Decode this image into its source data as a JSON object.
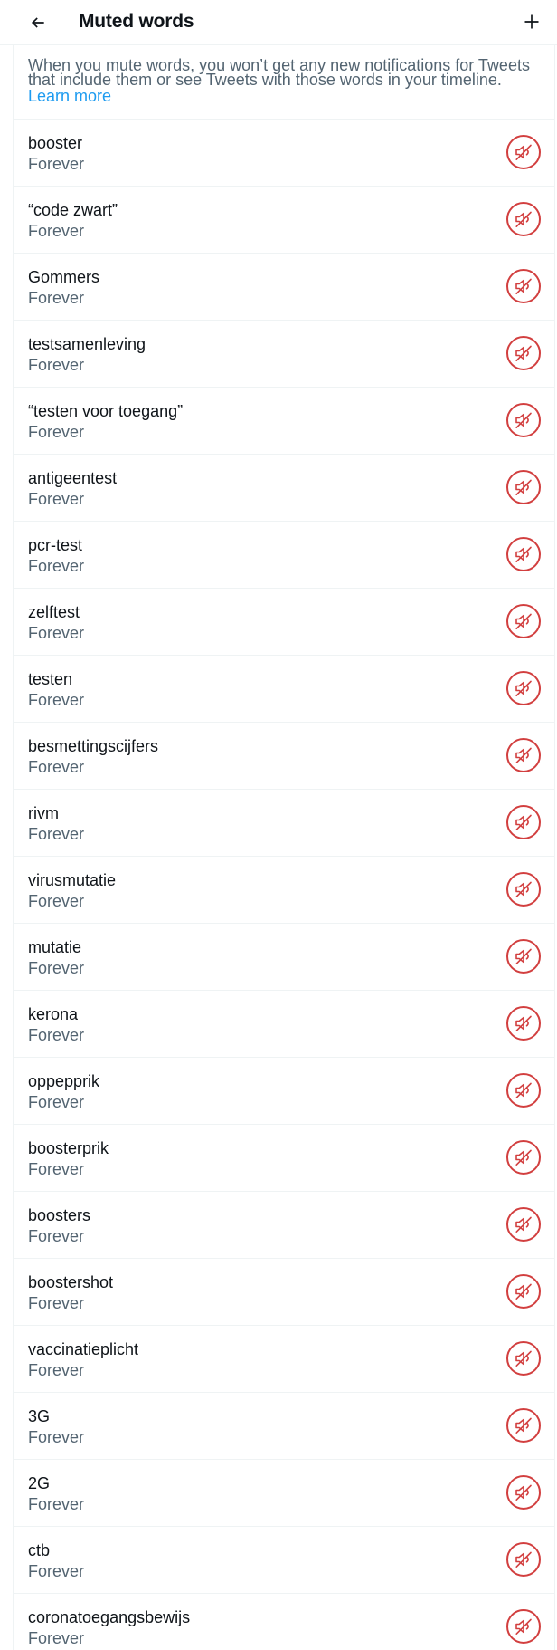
{
  "header": {
    "title": "Muted words",
    "back_icon": "arrow-left-icon",
    "add_icon": "plus-icon"
  },
  "intro": {
    "text": "When you mute words, you won’t get any new notifications for Tweets that include them or see Tweets with those words in your timeline.",
    "link": "Learn more"
  },
  "colors": {
    "accent": "#1d9bf0",
    "unmute": "#d23f3f",
    "secondary_text": "#536471",
    "divider": "#eff3f4"
  },
  "muted_words": [
    {
      "word": "booster",
      "duration": "Forever"
    },
    {
      "word": "“code zwart”",
      "duration": "Forever"
    },
    {
      "word": "Gommers",
      "duration": "Forever"
    },
    {
      "word": "testsamenleving",
      "duration": "Forever"
    },
    {
      "word": "“testen voor toegang”",
      "duration": "Forever"
    },
    {
      "word": "antigeentest",
      "duration": "Forever"
    },
    {
      "word": "pcr-test",
      "duration": "Forever"
    },
    {
      "word": "zelftest",
      "duration": "Forever"
    },
    {
      "word": "testen",
      "duration": "Forever"
    },
    {
      "word": "besmettingscijfers",
      "duration": "Forever"
    },
    {
      "word": "rivm",
      "duration": "Forever"
    },
    {
      "word": "virusmutatie",
      "duration": "Forever"
    },
    {
      "word": "mutatie",
      "duration": "Forever"
    },
    {
      "word": "kerona",
      "duration": "Forever"
    },
    {
      "word": "oppepprik",
      "duration": "Forever"
    },
    {
      "word": "boosterprik",
      "duration": "Forever"
    },
    {
      "word": "boosters",
      "duration": "Forever"
    },
    {
      "word": "boostershot",
      "duration": "Forever"
    },
    {
      "word": "vaccinatieplicht",
      "duration": "Forever"
    },
    {
      "word": "3G",
      "duration": "Forever"
    },
    {
      "word": "2G",
      "duration": "Forever"
    },
    {
      "word": "ctb",
      "duration": "Forever"
    },
    {
      "word": "coronatoegangsbewijs",
      "duration": "Forever"
    }
  ],
  "row_icon": "speaker-muted-icon"
}
